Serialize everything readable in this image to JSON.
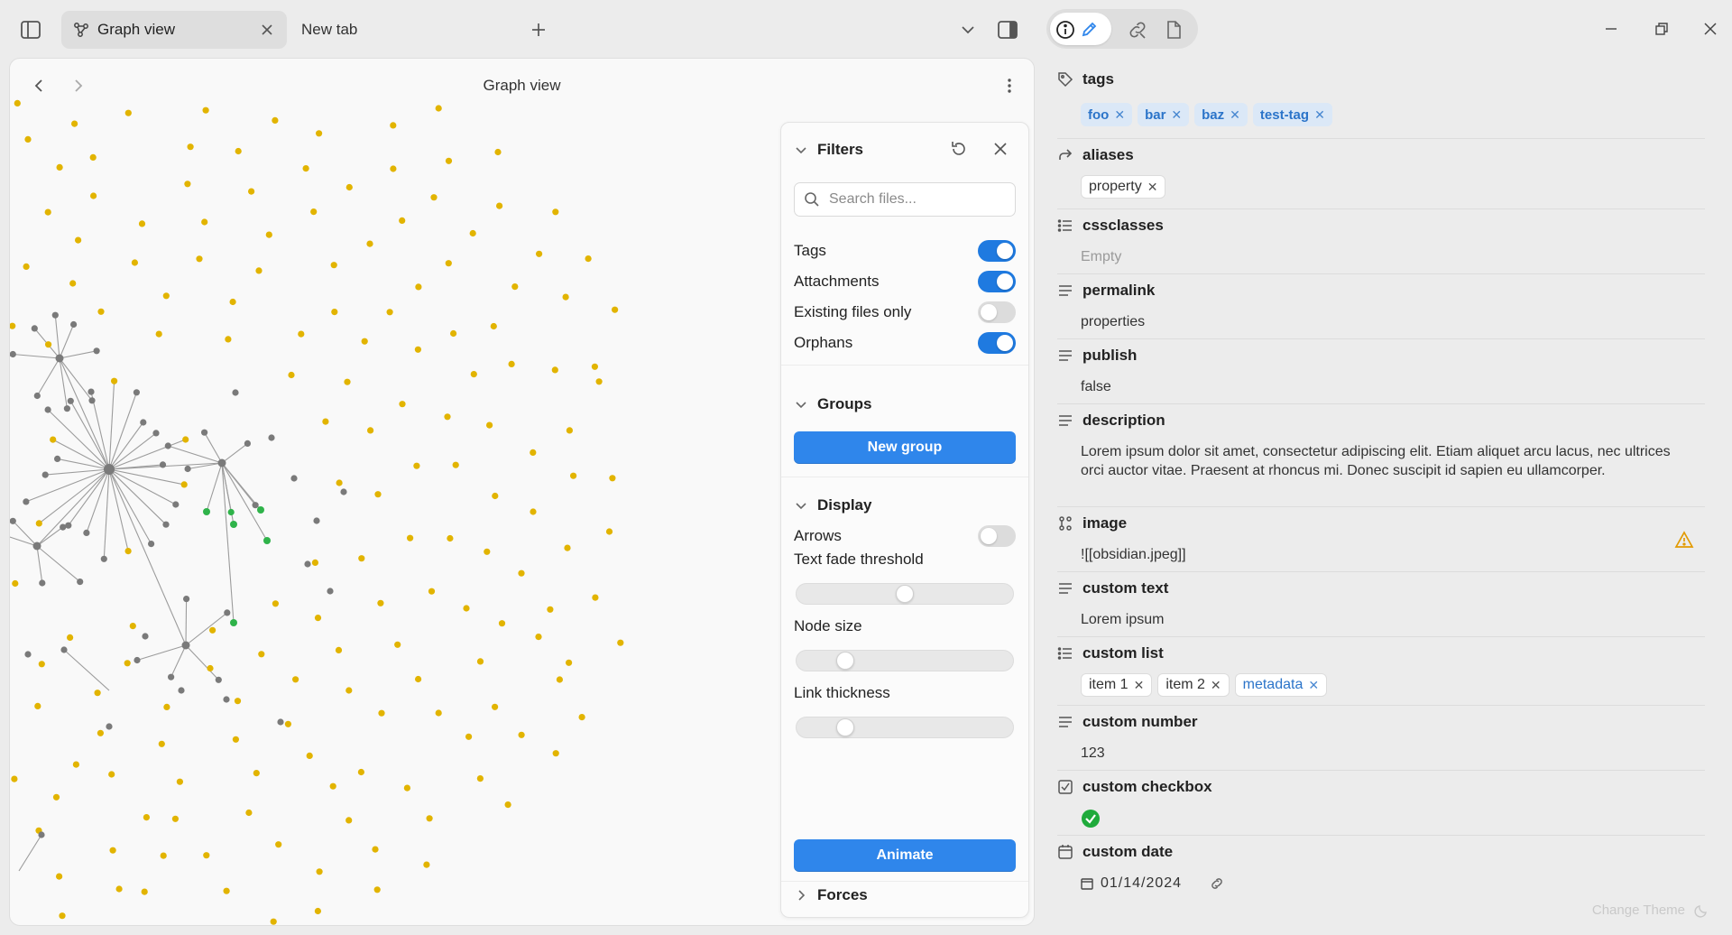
{
  "tabs": [
    {
      "label": "Graph view",
      "active": true
    },
    {
      "label": "New tab",
      "active": false
    }
  ],
  "graph": {
    "title": "Graph view",
    "colors": {
      "attachment": "#e2b400",
      "note": "#7a7a7a",
      "tag": "#2fb34a",
      "link": "#9c9c9c"
    }
  },
  "filters": {
    "title": "Filters",
    "search_placeholder": "Search files...",
    "options": [
      {
        "label": "Tags",
        "on": true
      },
      {
        "label": "Attachments",
        "on": true
      },
      {
        "label": "Existing files only",
        "on": false
      },
      {
        "label": "Orphans",
        "on": true
      }
    ],
    "groups": {
      "title": "Groups",
      "new_group_label": "New group"
    },
    "display": {
      "title": "Display",
      "arrows_label": "Arrows",
      "arrows_on": false,
      "sliders": [
        {
          "label": "Text fade threshold",
          "value": 0.5
        },
        {
          "label": "Node size",
          "value": 0.2
        },
        {
          "label": "Link thickness",
          "value": 0.2
        }
      ],
      "animate_label": "Animate"
    },
    "forces": {
      "title": "Forces"
    }
  },
  "properties": {
    "tags": {
      "key": "tags",
      "values": [
        "foo",
        "bar",
        "baz",
        "test-tag"
      ]
    },
    "aliases": {
      "key": "aliases",
      "values": [
        "property"
      ]
    },
    "cssclasses": {
      "key": "cssclasses",
      "value": "Empty"
    },
    "permalink": {
      "key": "permalink",
      "value": "properties"
    },
    "publish": {
      "key": "publish",
      "value": "false"
    },
    "description": {
      "key": "description",
      "value": "Lorem ipsum dolor sit amet, consectetur adipiscing elit. Etiam aliquet arcu lacus, nec ultrices orci auctor vitae. Praesent at rhoncus mi. Donec suscipit id sapien eu ullamcorper."
    },
    "image": {
      "key": "image",
      "value": "![[obsidian.jpeg]]"
    },
    "custom_text": {
      "key": "custom text",
      "value": "Lorem ipsum"
    },
    "custom_list": {
      "key": "custom list",
      "values": [
        "item 1",
        "item 2",
        "metadata"
      ]
    },
    "custom_number": {
      "key": "custom number",
      "value": "123"
    },
    "custom_checkbox": {
      "key": "custom checkbox",
      "checked": true
    },
    "custom_date": {
      "key": "custom date",
      "value": "01/14/2024"
    }
  },
  "footer": {
    "change_theme": "Change Theme"
  },
  "accent_color": "#2f86eb"
}
